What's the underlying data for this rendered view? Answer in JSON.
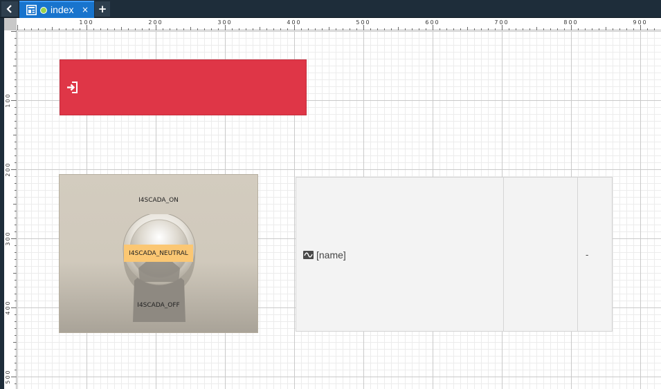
{
  "tabs": {
    "active_title": "index",
    "close_glyph": "×",
    "add_glyph": "+",
    "back_icon": "chevron-left-icon",
    "page_icon": "page-layout-icon",
    "status_color": "#9bd34b"
  },
  "rulers": {
    "horizontal_labels": [
      "100",
      "200",
      "300",
      "400",
      "500",
      "600",
      "700",
      "800",
      "900"
    ],
    "vertical_labels": [
      "100",
      "200",
      "300",
      "400",
      "500"
    ]
  },
  "login_button": {
    "icon": "sign-in-icon",
    "color": "#df3647"
  },
  "rotary_switch": {
    "label_on": "I4SCADA_ON",
    "label_neutral": "I4SCADA_NEUTRAL",
    "label_off": "I4SCADA_OFF",
    "neutral_color": "#fbc773"
  },
  "signal_display": {
    "icon": "signal-wave-icon",
    "name": "[name]",
    "value": "-"
  }
}
